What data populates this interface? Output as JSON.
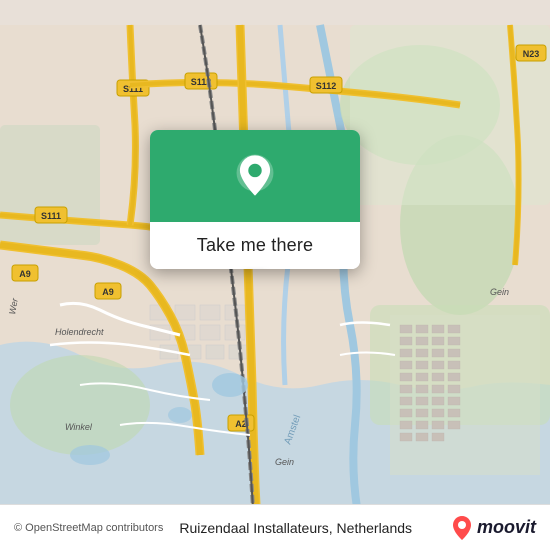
{
  "map": {
    "background_color": "#e8ddd0",
    "attribution": "© OpenStreetMap contributors"
  },
  "popup": {
    "button_label": "Take me there",
    "pin_color": "#2eaa6e"
  },
  "footer": {
    "business_name": "Ruizendaal Installateurs, Netherlands",
    "attribution": "© OpenStreetMap contributors",
    "brand": "moovit"
  },
  "roads": {
    "highway_color": "#f5c842",
    "road_color": "#ffffff",
    "route_color": "#c8a96e"
  }
}
